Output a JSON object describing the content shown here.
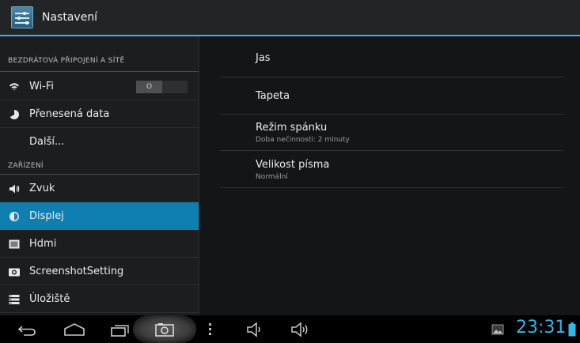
{
  "app": {
    "title": "Nastavení",
    "icon": "settings-sliders-icon"
  },
  "accent_color": "#33b5e5",
  "selected_color": "#0f7fb1",
  "sidebar": {
    "sections": [
      {
        "header": "BEZDRÁTOVÁ PŘIPOJENÍ A SÍTĚ",
        "items": [
          {
            "label": "Wi-Fi",
            "icon": "wifi-icon",
            "toggle": "O"
          },
          {
            "label": "Přenesená data",
            "icon": "data-usage-icon"
          },
          {
            "label": "Další...",
            "icon": ""
          }
        ]
      },
      {
        "header": "ZAŘÍZENÍ",
        "items": [
          {
            "label": "Zvuk",
            "icon": "speaker-icon"
          },
          {
            "label": "Displej",
            "icon": "brightness-icon",
            "selected": true
          },
          {
            "label": "Hdmi",
            "icon": "hdmi-icon"
          },
          {
            "label": "ScreenshotSetting",
            "icon": "camera-icon"
          },
          {
            "label": "Úložiště",
            "icon": "storage-icon"
          }
        ]
      }
    ]
  },
  "display_prefs": [
    {
      "title": "Jas",
      "summary": ""
    },
    {
      "title": "Tapeta",
      "summary": ""
    },
    {
      "title": "Režim spánku",
      "summary": "Doba nečinnosti: 2 minuty"
    },
    {
      "title": "Velikost písma",
      "summary": "Normální"
    }
  ],
  "status": {
    "time": "23:31"
  },
  "navbar": {
    "buttons": [
      "back-icon",
      "home-icon",
      "recent-apps-icon",
      "screenshot-icon",
      "menu-icon",
      "volume-down-icon",
      "volume-up-icon"
    ],
    "notification_icon": "image-icon",
    "battery_icon": "battery-icon"
  }
}
